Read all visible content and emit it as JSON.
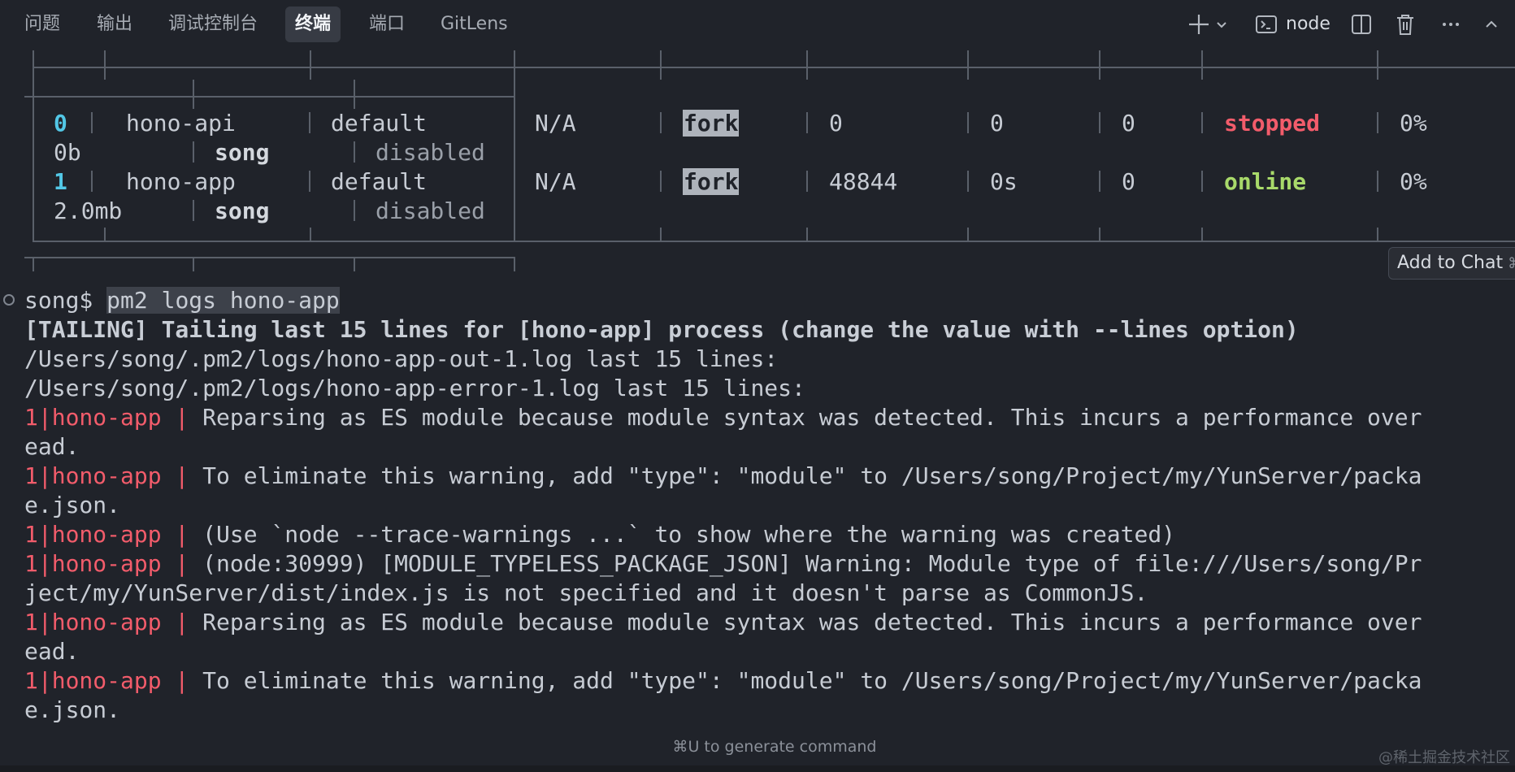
{
  "tabs": [
    {
      "label": "问题",
      "active": false
    },
    {
      "label": "输出",
      "active": false
    },
    {
      "label": "调试控制台",
      "active": false
    },
    {
      "label": "终端",
      "active": true
    },
    {
      "label": "端口",
      "active": false
    },
    {
      "label": "GitLens",
      "active": false
    }
  ],
  "toolbar": {
    "new_terminal_icon": "plus-icon",
    "dropdown_icon": "chevron-down-icon",
    "terminal_icon": "terminal-icon",
    "terminal_name": "node",
    "split_icon": "split-icon",
    "trash_icon": "trash-icon",
    "more_icon": "ellipsis-icon",
    "collapse_icon": "chevron-up-icon"
  },
  "pm2_table": {
    "rows": [
      {
        "id": "0",
        "name": "hono-api",
        "namespace": "default",
        "version": "N/A",
        "mode": "fork",
        "pid": "0",
        "uptime": "0",
        "restarts": "0",
        "status": "stopped",
        "cpu": "0%",
        "mem": "0b",
        "user": "song",
        "watching": "disabled"
      },
      {
        "id": "1",
        "name": "hono-app",
        "namespace": "default",
        "version": "N/A",
        "mode": "fork",
        "pid": "48844",
        "uptime": "0s",
        "restarts": "0",
        "status": "online",
        "cpu": "0%",
        "mem": "2.0mb",
        "user": "song",
        "watching": "disabled"
      }
    ]
  },
  "tooltip": {
    "label": "Add to Chat",
    "shortcut": "⌘"
  },
  "terminal": {
    "prompt": "song$ ",
    "command": "pm2 logs hono-app",
    "tailing": "[TAILING] Tailing last 15 lines for [hono-app] process (change the value with --lines option)",
    "out_log": "/Users/song/.pm2/logs/hono-app-out-1.log last 15 lines:",
    "err_log": "/Users/song/.pm2/logs/hono-app-error-1.log last 15 lines:",
    "prefix": "1|hono-app | ",
    "lines": [
      {
        "pfx": true,
        "text": "Reparsing as ES module because module syntax was detected. This incurs a performance over"
      },
      {
        "pfx": false,
        "text": "ead."
      },
      {
        "pfx": true,
        "text": "To eliminate this warning, add \"type\": \"module\" to /Users/song/Project/my/YunServer/packa"
      },
      {
        "pfx": false,
        "text": "e.json."
      },
      {
        "pfx": true,
        "text": "(Use `node --trace-warnings ...` to show where the warning was created)"
      },
      {
        "pfx": true,
        "text": "(node:30999) [MODULE_TYPELESS_PACKAGE_JSON] Warning: Module type of file:///Users/song/Pr"
      },
      {
        "pfx": false,
        "text": "ject/my/YunServer/dist/index.js is not specified and it doesn't parse as CommonJS."
      },
      {
        "pfx": true,
        "text": "Reparsing as ES module because module syntax was detected. This incurs a performance over"
      },
      {
        "pfx": false,
        "text": "ead."
      },
      {
        "pfx": true,
        "text": "To eliminate this warning, add \"type\": \"module\" to /Users/song/Project/my/YunServer/packa"
      },
      {
        "pfx": false,
        "text": "e.json."
      }
    ]
  },
  "hint": "⌘U to generate command",
  "watermark": "@稀土掘金技术社区"
}
